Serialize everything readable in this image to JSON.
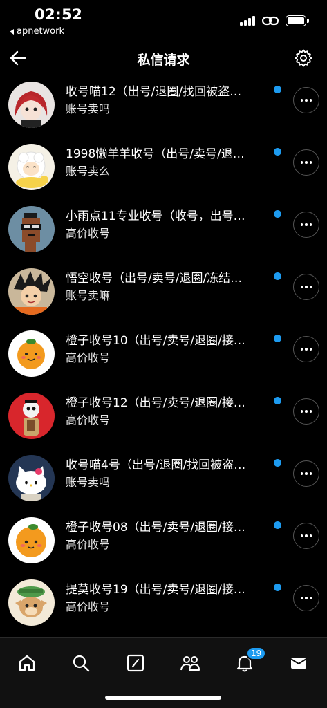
{
  "status_bar": {
    "time": "02:52",
    "back_app": "apnetwork"
  },
  "header": {
    "title": "私信请求"
  },
  "requests": [
    {
      "title": "收号喵12（出号/退圈/找回被盗…",
      "preview": "账号卖吗",
      "unread": true,
      "avatar": "anime-girl-red-hair"
    },
    {
      "title": "1998懒羊羊收号（出号/卖号/退…",
      "preview": "账号卖么",
      "unread": true,
      "avatar": "lazy-sheep"
    },
    {
      "title": "小雨点11专业收号（收号，出号…",
      "preview": "高价收号",
      "unread": true,
      "avatar": "pixel-punk"
    },
    {
      "title": "悟空收号（出号/卖号/退圈/冻结…",
      "preview": "账号卖嘛",
      "unread": true,
      "avatar": "goku"
    },
    {
      "title": "橙子收号10（出号/卖号/退圈/接…",
      "preview": "高价收号",
      "unread": true,
      "avatar": "orange-character"
    },
    {
      "title": "橙子收号12（出号/卖号/退圈/接…",
      "preview": "高价收号",
      "unread": true,
      "avatar": "skull-figure"
    },
    {
      "title": "收号喵4号（出号/退圈/找回被盗…",
      "preview": "账号卖吗",
      "unread": true,
      "avatar": "hello-kitty"
    },
    {
      "title": "橙子收号08（出号/卖号/退圈/接…",
      "preview": "高价收号",
      "unread": true,
      "avatar": "orange-character"
    },
    {
      "title": "提莫收号19（出号/卖号/退圈/接…",
      "preview": "高价收号",
      "unread": true,
      "avatar": "teemo"
    }
  ],
  "bottom_nav": {
    "items": [
      "home-icon",
      "search-icon",
      "compose-icon",
      "communities-icon",
      "notifications-icon",
      "messages-icon"
    ],
    "notification_badge": "19"
  },
  "colors": {
    "accent": "#1d9bf0",
    "background": "#000000"
  }
}
